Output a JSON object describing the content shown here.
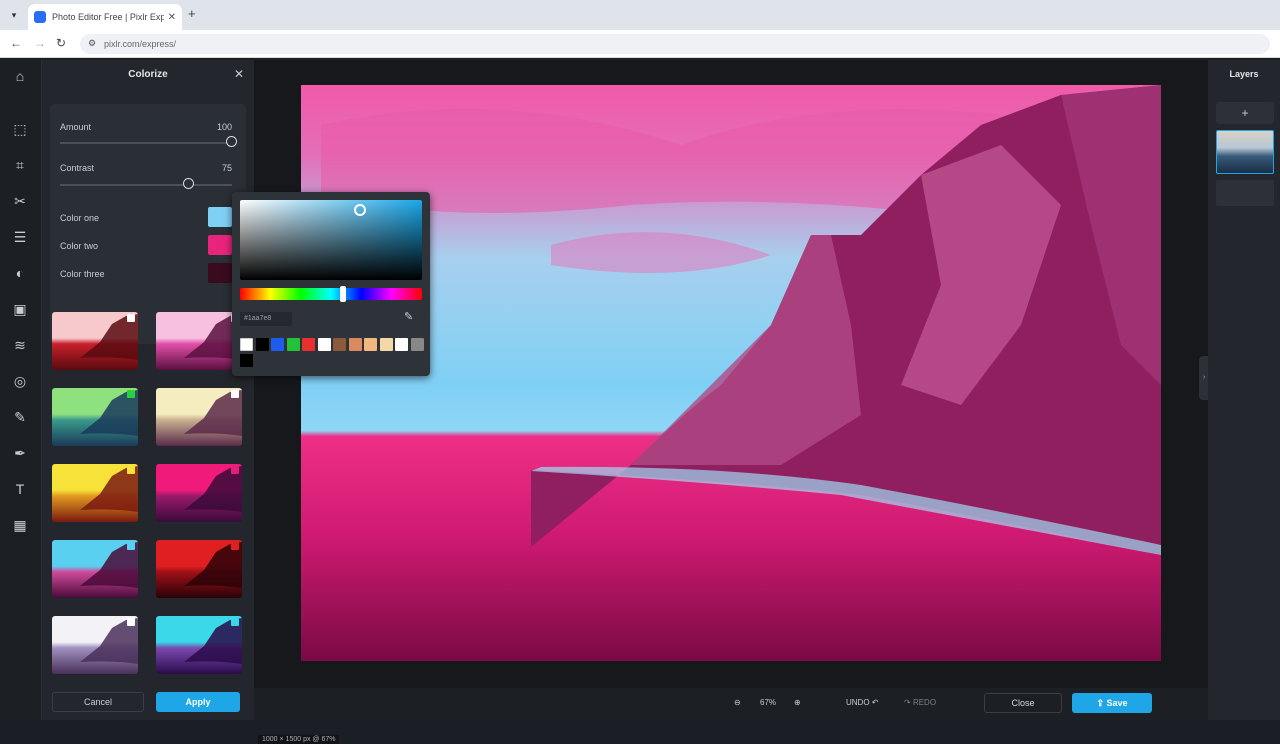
{
  "browser": {
    "tab_title": "Photo Editor Free | Pixlr Expre...",
    "url": "pixlr.com/express/"
  },
  "panel": {
    "title": "Colorize",
    "amount_label": "Amount",
    "amount_value": "100",
    "amount_level": 1.0,
    "contrast_label": "Contrast",
    "contrast_value": "75",
    "contrast_level": 0.75,
    "color_one_label": "Color one",
    "color_two_label": "Color two",
    "color_three_label": "Color three",
    "color_one": "#7fd0f5",
    "color_two": "#e8247d",
    "color_three": "#3a0a1f",
    "cancel_label": "Cancel",
    "apply_label": "Apply"
  },
  "picker": {
    "hex_value": "#1aa7e8",
    "palette": [
      "#ffffff",
      "#000000",
      "#1e5cf0",
      "#22c23a",
      "#e83030",
      "#ffffff",
      "#8b5a3c",
      "#d98a5e",
      "#f0b880",
      "#f5d8a8",
      "#ffffff",
      "#888888",
      "#000000"
    ]
  },
  "presets": [
    {
      "name": "red",
      "tint": [
        "#f7c8cc",
        "#c8202a",
        "#5a0a10"
      ],
      "dot": "#ffffff"
    },
    {
      "name": "pink",
      "tint": [
        "#f7c0e0",
        "#e24ea8",
        "#5a1040"
      ],
      "dot": "#ffffff"
    },
    {
      "name": "green-blue",
      "tint": [
        "#8fe07f",
        "#3a9a8a",
        "#1a3a5a"
      ],
      "dot": "#2ad23a"
    },
    {
      "name": "cream",
      "tint": [
        "#f5ecc0",
        "#c9b090",
        "#5a2a4a"
      ],
      "dot": "#ffffff"
    },
    {
      "name": "yellow",
      "tint": [
        "#f7e23a",
        "#e29a20",
        "#7a1a10"
      ],
      "dot": "#f7e23a"
    },
    {
      "name": "magenta",
      "tint": [
        "#f01a7a",
        "#9a1a6a",
        "#3a0a3a"
      ],
      "dot": "#e2207a"
    },
    {
      "name": "cyan-pink",
      "tint": [
        "#5ad0f0",
        "#d04a9a",
        "#4a0a3a"
      ],
      "dot": "#5ad0f0"
    },
    {
      "name": "deep-red",
      "tint": [
        "#e02020",
        "#a01018",
        "#2a0208"
      ],
      "dot": "#e02020"
    },
    {
      "name": "white-lavender",
      "tint": [
        "#f2f2f7",
        "#a090c0",
        "#4a305a"
      ],
      "dot": "#ffffff"
    },
    {
      "name": "cyan-purple",
      "tint": [
        "#3ad8e8",
        "#7a4ab0",
        "#2a0a4a"
      ],
      "dot": "#3ad8e8"
    }
  ],
  "canvas": {
    "dimensions_label": "1000 × 1500 px @ 67%"
  },
  "bottombar": {
    "zoom_value": "67%",
    "undo_label": "UNDO",
    "redo_label": "REDO",
    "close_label": "Close",
    "save_label": "Save"
  },
  "layers": {
    "title": "Layers"
  }
}
